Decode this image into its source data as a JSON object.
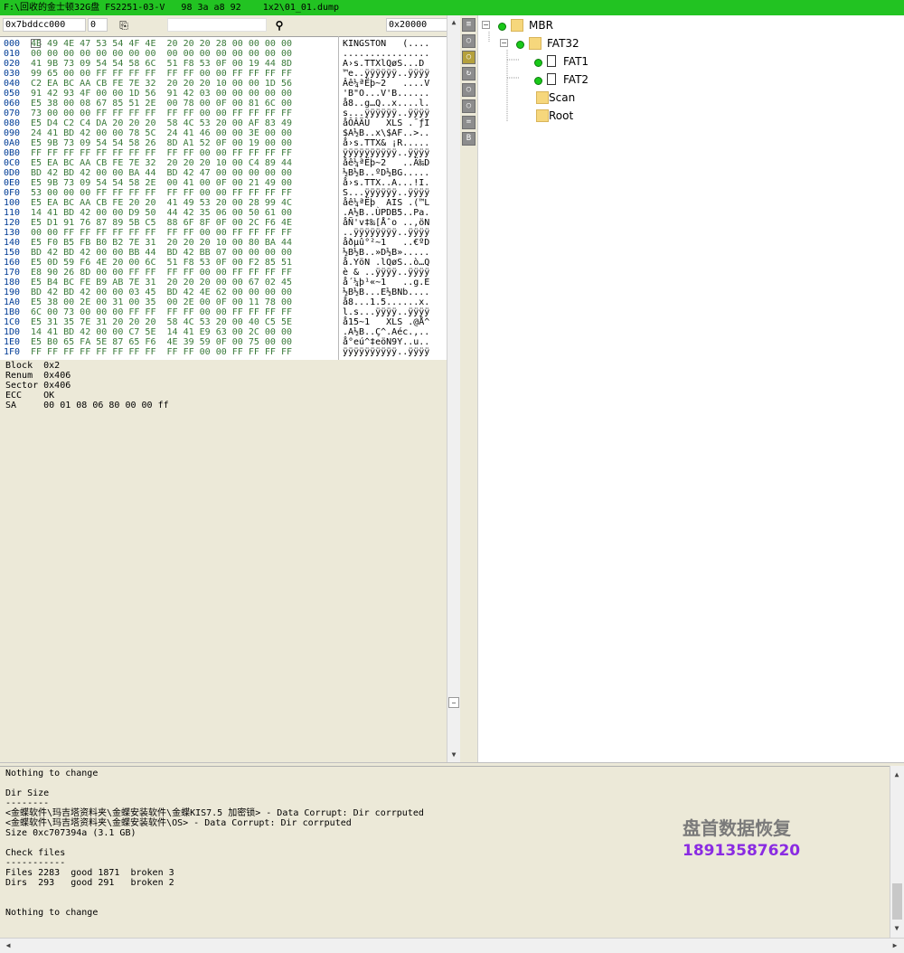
{
  "window": {
    "title": "F:\\回收的金士顿32G盘 FS2251-03-V   98 3a a8 92    1x2\\01_01.dump"
  },
  "toolbar": {
    "address": "0x7bddcc000",
    "offset": "0",
    "size": "0x20000",
    "copy_icon": "copy-icon",
    "find_icon": "binoculars-icon"
  },
  "hex": {
    "rows": [
      {
        "off": "000",
        "hex": "4B 49 4E 47 53 54 4F 4E  20 20 20 28 00 00 00 00",
        "asc": "KINGSTON   (...."
      },
      {
        "off": "010",
        "hex": "00 00 00 00 00 00 00 00  00 00 00 00 00 00 00 00",
        "asc": "................"
      },
      {
        "off": "020",
        "hex": "41 9B 73 09 54 54 58 6C  51 F8 53 0F 00 19 44 8D",
        "asc": "A›s.TTXlQøS...D"
      },
      {
        "off": "030",
        "hex": "99 65 00 00 FF FF FF FF  FF FF 00 00 FF FF FF FF",
        "asc": "™e..ÿÿÿÿÿÿ..ÿÿÿÿ"
      },
      {
        "off": "040",
        "hex": "C2 EA BC AA CB FE 7E 32  20 20 20 10 00 00 1D 56",
        "asc": "Âê¼ªËþ~2   ....V"
      },
      {
        "off": "050",
        "hex": "91 42 93 4F 00 00 1D 56  91 42 03 00 00 00 00 00",
        "asc": "'B\"O...V'B......"
      },
      {
        "off": "060",
        "hex": "E5 38 00 08 67 85 51 2E  00 78 00 0F 00 81 6C 00",
        "asc": "å8..g…Q..x....l."
      },
      {
        "off": "070",
        "hex": "73 00 00 00 FF FF FF FF  FF FF 00 00 FF FF FF FF",
        "asc": "s...ÿÿÿÿÿÿ..ÿÿÿÿ"
      },
      {
        "off": "080",
        "hex": "E5 D4 C2 C4 DA 20 20 20  58 4C 53 20 00 AF 83 49",
        "asc": "åÔÂÄÚ   XLS .¯ƒI"
      },
      {
        "off": "090",
        "hex": "24 41 BD 42 00 00 78 5C  24 41 46 00 00 3E 00 00",
        "asc": "$A½B..x\\$AF..>.."
      },
      {
        "off": "0A0",
        "hex": "E5 9B 73 09 54 54 58 26  8D A1 52 0F 00 19 00 00",
        "asc": "å›s.TTX& ¡R....."
      },
      {
        "off": "0B0",
        "hex": "FF FF FF FF FF FF FF FF  FF FF 00 00 FF FF FF FF",
        "asc": "ÿÿÿÿÿÿÿÿÿÿ..ÿÿÿÿ"
      },
      {
        "off": "0C0",
        "hex": "E5 EA BC AA CB FE 7E 32  20 20 20 10 00 C4 89 44",
        "asc": "åê¼ªËþ~2   ..Ä‰D"
      },
      {
        "off": "0D0",
        "hex": "BD 42 BD 42 00 00 BA 44  BD 42 47 00 00 00 00 00",
        "asc": "½B½B..ºD½BG....."
      },
      {
        "off": "0E0",
        "hex": "E5 9B 73 09 54 54 58 2E  00 41 00 0F 00 21 49 00",
        "asc": "å›s.TTX..A...!I."
      },
      {
        "off": "0F0",
        "hex": "53 00 00 00 FF FF FF FF  FF FF 00 00 FF FF FF FF",
        "asc": "S...ÿÿÿÿÿÿ..ÿÿÿÿ"
      },
      {
        "off": "100",
        "hex": "E5 EA BC AA CB FE 20 20  41 49 53 20 00 28 99 4C",
        "asc": "åê¼ªËþ  AIS .(™L"
      },
      {
        "off": "110",
        "hex": "14 41 BD 42 00 00 D9 50  44 42 35 06 00 50 61 00",
        "asc": ".A½B..ÙPDB5..Pa."
      },
      {
        "off": "120",
        "hex": "E5 D1 91 76 87 89 5B C5  88 6F 8F 0F 00 2C F6 4E",
        "asc": "åÑ'v‡‰[Åˆo ..,öN"
      },
      {
        "off": "130",
        "hex": "00 00 FF FF FF FF FF FF  FF FF 00 00 FF FF FF FF",
        "asc": "..ÿÿÿÿÿÿÿÿ..ÿÿÿÿ"
      },
      {
        "off": "140",
        "hex": "E5 F0 B5 FB B0 B2 7E 31  20 20 20 10 00 80 BA 44",
        "asc": "åðµû°²~1   ..€ºD"
      },
      {
        "off": "150",
        "hex": "BD 42 BD 42 00 00 BB 44  BD 42 BB 07 00 00 00 00",
        "asc": "½B½B..»D½B»....."
      },
      {
        "off": "160",
        "hex": "E5 0D 59 F6 4E 20 00 6C  51 F8 53 0F 00 F2 85 51",
        "asc": "å.YöN .lQøS..ò…Q"
      },
      {
        "off": "170",
        "hex": "E8 90 26 8D 00 00 FF FF  FF FF 00 00 FF FF FF FF",
        "asc": "è & ..ÿÿÿÿ..ÿÿÿÿ"
      },
      {
        "off": "180",
        "hex": "E5 B4 BC FE B9 AB 7E 31  20 20 20 00 00 67 02 45",
        "asc": "å´¼þ¹«~1   ..g.E"
      },
      {
        "off": "190",
        "hex": "BD 42 BD 42 00 00 03 45  BD 42 4E 62 00 00 00 00",
        "asc": "½B½B...E½BNb...."
      },
      {
        "off": "1A0",
        "hex": "E5 38 00 2E 00 31 00 35  00 2E 00 0F 00 11 78 00",
        "asc": "å8...1.5......x."
      },
      {
        "off": "1B0",
        "hex": "6C 00 73 00 00 00 FF FF  FF FF 00 00 FF FF FF FF",
        "asc": "l.s...ÿÿÿÿ..ÿÿÿÿ"
      },
      {
        "off": "1C0",
        "hex": "E5 31 35 7E 31 20 20 20  58 4C 53 20 00 40 C5 5E",
        "asc": "å15~1   XLS .@Å^"
      },
      {
        "off": "1D0",
        "hex": "14 41 BD 42 00 00 C7 5E  14 41 E9 63 00 2C 00 00",
        "asc": ".A½B..Ç^.Aéc.,.."
      },
      {
        "off": "1E0",
        "hex": "E5 B0 65 FA 5E 87 65 F6  4E 39 59 0F 00 75 00 00",
        "asc": "å°eú^‡eöN9Y..u.."
      },
      {
        "off": "1F0",
        "hex": "FF FF FF FF FF FF FF FF  FF FF 00 00 FF FF FF FF",
        "asc": "ÿÿÿÿÿÿÿÿÿÿ..ÿÿÿÿ"
      }
    ]
  },
  "info": {
    "lines": [
      "Block  0x2",
      "Renum  0x406",
      "Sector 0x406",
      "ECC    OK",
      "SA     00 01 08 06 80 00 00 ff"
    ]
  },
  "tree": {
    "nodes": [
      {
        "label": "MBR",
        "depth": 0,
        "expander": "−",
        "dot": true,
        "icon": "folder"
      },
      {
        "label": "FAT32",
        "depth": 1,
        "expander": "−",
        "dot": true,
        "icon": "folder"
      },
      {
        "label": "FAT1",
        "depth": 2,
        "expander": "",
        "dot": true,
        "icon": "file"
      },
      {
        "label": "FAT2",
        "depth": 2,
        "expander": "",
        "dot": true,
        "icon": "file"
      },
      {
        "label": "Scan",
        "depth": 2,
        "expander": "+",
        "dot": false,
        "icon": "folder"
      },
      {
        "label": "Root",
        "depth": 2,
        "expander": "+",
        "dot": false,
        "icon": "folder"
      }
    ]
  },
  "sidebuttons": [
    "≡",
    "○",
    "○",
    "↻",
    "○",
    "○",
    "=",
    "B"
  ],
  "log": {
    "lines": [
      "Nothing to change",
      "",
      "Dir Size",
      "--------",
      "<金蝶软件\\玛吉塔资料夹\\金蝶安装软件\\金蝶KIS7.5 加密锁> - Data Corrupt: Dir corrputed",
      "<金蝶软件\\玛吉塔资料夹\\金蝶安装软件\\OS> - Data Corrupt: Dir corrputed",
      "Size 0xc707394a (3.1 GB)",
      "",
      "Check files",
      "-----------",
      "Files 2283  good 1871  broken 3",
      "Dirs  293   good 291   broken 2",
      "",
      "",
      "Nothing to change"
    ]
  },
  "watermark": {
    "line1": "盘首数据恢复",
    "line2": "18913587620"
  },
  "colors": {
    "titlebar": "#22c322",
    "hex_offset": "#003c96",
    "hex_bytes": "#3a7a3a",
    "dot_green": "#19c819",
    "watermark_phone": "#8a2be2"
  }
}
